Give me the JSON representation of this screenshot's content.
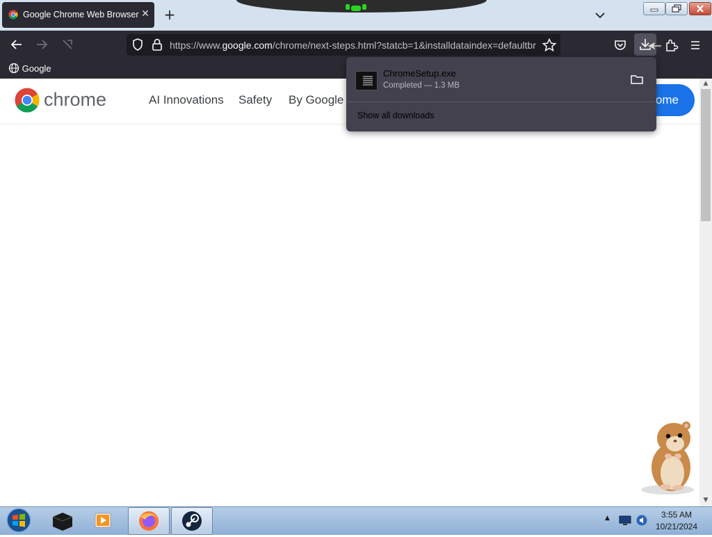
{
  "tab": {
    "title": "Google Chrome Web Browser"
  },
  "toolbar": {
    "url_prefix": "https://www.",
    "url_host": "google.com",
    "url_rest": "/chrome/next-steps.html?statcb=1&installdataindex=defaultbr"
  },
  "bookmarks": [
    {
      "label": "Google"
    }
  ],
  "site": {
    "logo_text": "chrome",
    "nav": [
      "AI Innovations",
      "Safety",
      "By Google"
    ],
    "cta_visible": "ome"
  },
  "downloads_panel": {
    "filename": "ChromeSetup.exe",
    "status": "Completed — 1.3 MB",
    "show_all": "Show all downloads"
  },
  "taskbar": {
    "time": "3:55 AM",
    "date": "10/21/2024"
  },
  "colors": {
    "accent": "#1a73e8",
    "toolbar_bg": "#2b2a33",
    "panel_bg": "#42414d"
  }
}
